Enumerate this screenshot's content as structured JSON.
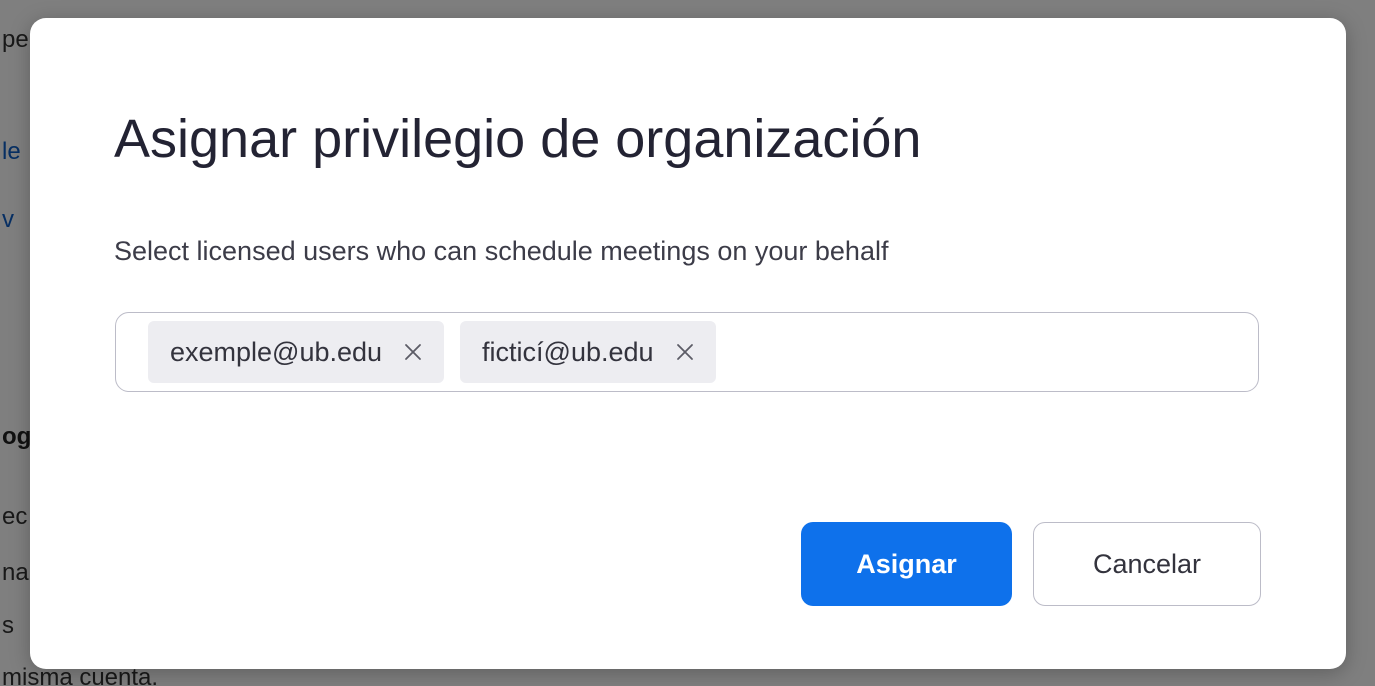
{
  "background": {
    "lines": [
      {
        "text": "pe",
        "style": "normal"
      },
      {
        "text": "le",
        "style": "link"
      },
      {
        "text": "v",
        "style": "link"
      },
      {
        "text": "og",
        "style": "bold"
      },
      {
        "text": "ec",
        "style": "normal"
      },
      {
        "text": "na",
        "style": "normal"
      },
      {
        "text": "s",
        "style": "normal"
      },
      {
        "text": "misma cuenta.",
        "style": "normal"
      }
    ]
  },
  "dialog": {
    "title": "Asignar privilegio de organización",
    "description": "Select licensed users who can schedule meetings on your behalf",
    "tags": [
      {
        "label": "exemple@ub.edu",
        "remove_icon": "close-icon"
      },
      {
        "label": "ficticí@ub.edu",
        "remove_icon": "close-icon"
      }
    ],
    "input_value": "",
    "buttons": {
      "assign": "Asignar",
      "cancel": "Cancelar"
    }
  },
  "colors": {
    "primary": "#0e71eb",
    "overlay": "rgba(0,0,0,0.5)",
    "title": "#232333",
    "link": "#0e5fc7"
  }
}
